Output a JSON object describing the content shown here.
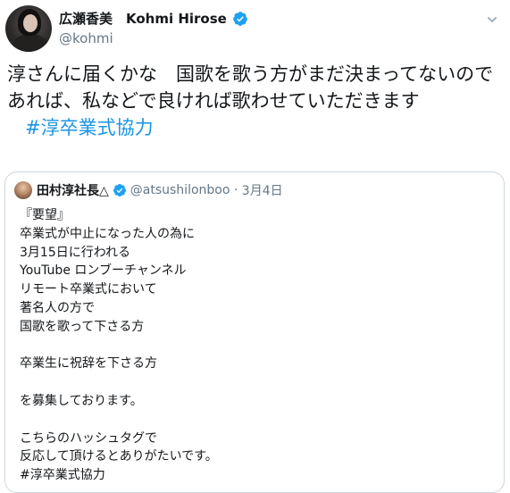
{
  "tweet": {
    "author": {
      "name": "広瀬香美　Kohmi Hirose",
      "handle": "@kohmi"
    },
    "text_line1": "淳さんに届くかな　国歌を歌う方がまだ決まってないのであれば、私などで良ければ歌わせていただきます",
    "hashtag": "#淳卒業式協力"
  },
  "quoted_tweet": {
    "author": {
      "name": "田村淳社長△",
      "handle": "@atsushilonboo",
      "date": "3月4日"
    },
    "lines": [
      "『要望』",
      "卒業式が中止になった人の為に",
      "3月15日に行われる",
      "YouTube ロンブーチャンネル",
      "リモート卒業式において",
      "著名人の方で",
      "国歌を歌って下さる方",
      "",
      "卒業生に祝辞を下さる方",
      "",
      "を募集しております。",
      "",
      "こちらのハッシュタグで",
      "反応して頂けるとありがたいです。",
      "#淳卒業式協力"
    ]
  },
  "colors": {
    "verified": "#1da1f2",
    "hashtag": "#1b95e0",
    "secondary_text": "#657786",
    "border": "#ccd6dd"
  },
  "icons": [
    "verified-badge-icon",
    "chevron-down-icon"
  ]
}
